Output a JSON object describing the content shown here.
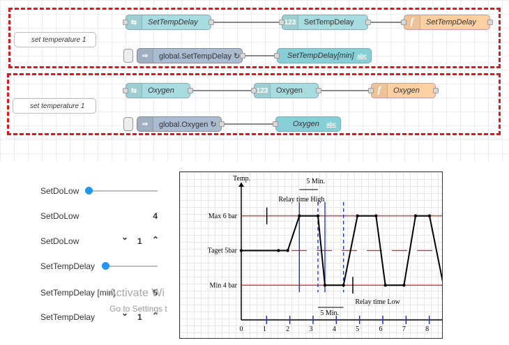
{
  "flow": {
    "group1": {
      "comment": "set temperature 1",
      "inject_a": "SetTempDelay",
      "number": "SetTempDelay",
      "function": "SetTempDelay",
      "global": "global.SetTempDelay ↻",
      "debug": "SetTempDelay[min]",
      "debug_tag": "abc"
    },
    "group2": {
      "comment": "set temperature 1",
      "inject_a": "Oxygen",
      "number": "Oxygen",
      "function": "Oxygen",
      "global": "global.Oxygen ↻",
      "debug": "Oxygen",
      "debug_tag": "abc"
    },
    "icons": {
      "change": "shuffle-icon",
      "number": "123",
      "function": "f",
      "inject": "arrow-icon"
    }
  },
  "dashboard": {
    "rows": [
      {
        "label": "SetDoLow",
        "type": "slider",
        "value": 0.0
      },
      {
        "label": "SetDoLow",
        "type": "text",
        "value": "4"
      },
      {
        "label": "SetDoLow",
        "type": "numeric",
        "value": "1",
        "down": "⌄",
        "up": "⌃"
      },
      {
        "label": "SetTempDelay",
        "type": "slider",
        "value": 0.05
      },
      {
        "label": "SetTempDelay [min]",
        "type": "text",
        "value": "5"
      },
      {
        "label": "SetTempDelay",
        "type": "numeric",
        "value": "1",
        "down": "⌄",
        "up": "⌃"
      }
    ],
    "watermark1": "Activate Wi",
    "watermark2": "Go to Settings t"
  },
  "chart_data": {
    "type": "line",
    "ylabel": "Temp.",
    "y_labels": [
      "Max 6 bar",
      "Taget 5bar",
      "Min 4 bar"
    ],
    "ylim": [
      3,
      7
    ],
    "xlim": [
      0,
      8.7
    ],
    "x_ticks": [
      "0",
      "1",
      "2",
      "3",
      "4",
      "5",
      "6",
      "7",
      "8"
    ],
    "annotations": [
      "5 Min.",
      "Relay time High",
      "5 Min.",
      "Relay time Low"
    ],
    "series": [
      {
        "x": [
          0,
          1.6,
          2.0,
          2.5,
          3.3,
          3.6,
          4.4,
          5.0,
          5.8,
          6.2,
          7.0,
          7.5,
          8.1,
          8.7
        ],
        "y": [
          5,
          5,
          5,
          6,
          6,
          4,
          4,
          6,
          6,
          4,
          4,
          6,
          6,
          4
        ]
      }
    ],
    "ref_lines": [
      6,
      4
    ],
    "target_line": 5,
    "colors": {
      "ref": "#e02020",
      "vline": "#2233cc",
      "line": "#000000"
    }
  }
}
